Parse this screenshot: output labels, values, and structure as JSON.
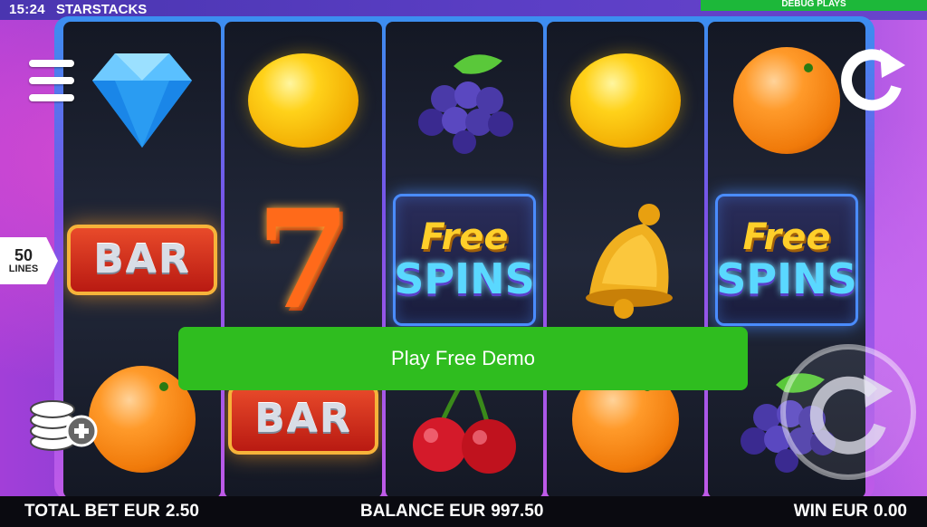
{
  "status": {
    "time": "15:24",
    "game_name": "STARSTACKS",
    "debug_label": "DEBUG PLAYS"
  },
  "reels": [
    [
      "diamond",
      "bar",
      "orange"
    ],
    [
      "lemon",
      "seven",
      "bar"
    ],
    [
      "grapes",
      "free-spins",
      "cherries"
    ],
    [
      "lemon",
      "bell",
      "orange"
    ],
    [
      "orange",
      "free-spins",
      "grapes"
    ]
  ],
  "symbols": {
    "bar_text": "BAR",
    "seven_text": "7",
    "free_text": "Free",
    "spins_text": "SPINS"
  },
  "lines": {
    "count": "50",
    "label": "LINES"
  },
  "demo_button": {
    "label": "Play Free Demo"
  },
  "bottom": {
    "total_bet_label": "TOTAL BET EUR",
    "total_bet_value": "2.50",
    "balance_label": "BALANCE EUR",
    "balance_value": "997.50",
    "win_label": "WIN EUR",
    "win_value": "0.00"
  },
  "colors": {
    "demo_green": "#2fbd1f",
    "debug_green": "#1db83a",
    "bottom_bar": "#0a0a10"
  },
  "icons": {
    "menu": "hamburger-icon",
    "coins": "coin-stack-plus-icon",
    "autoplay": "refresh-icon",
    "spin": "spin-icon"
  }
}
